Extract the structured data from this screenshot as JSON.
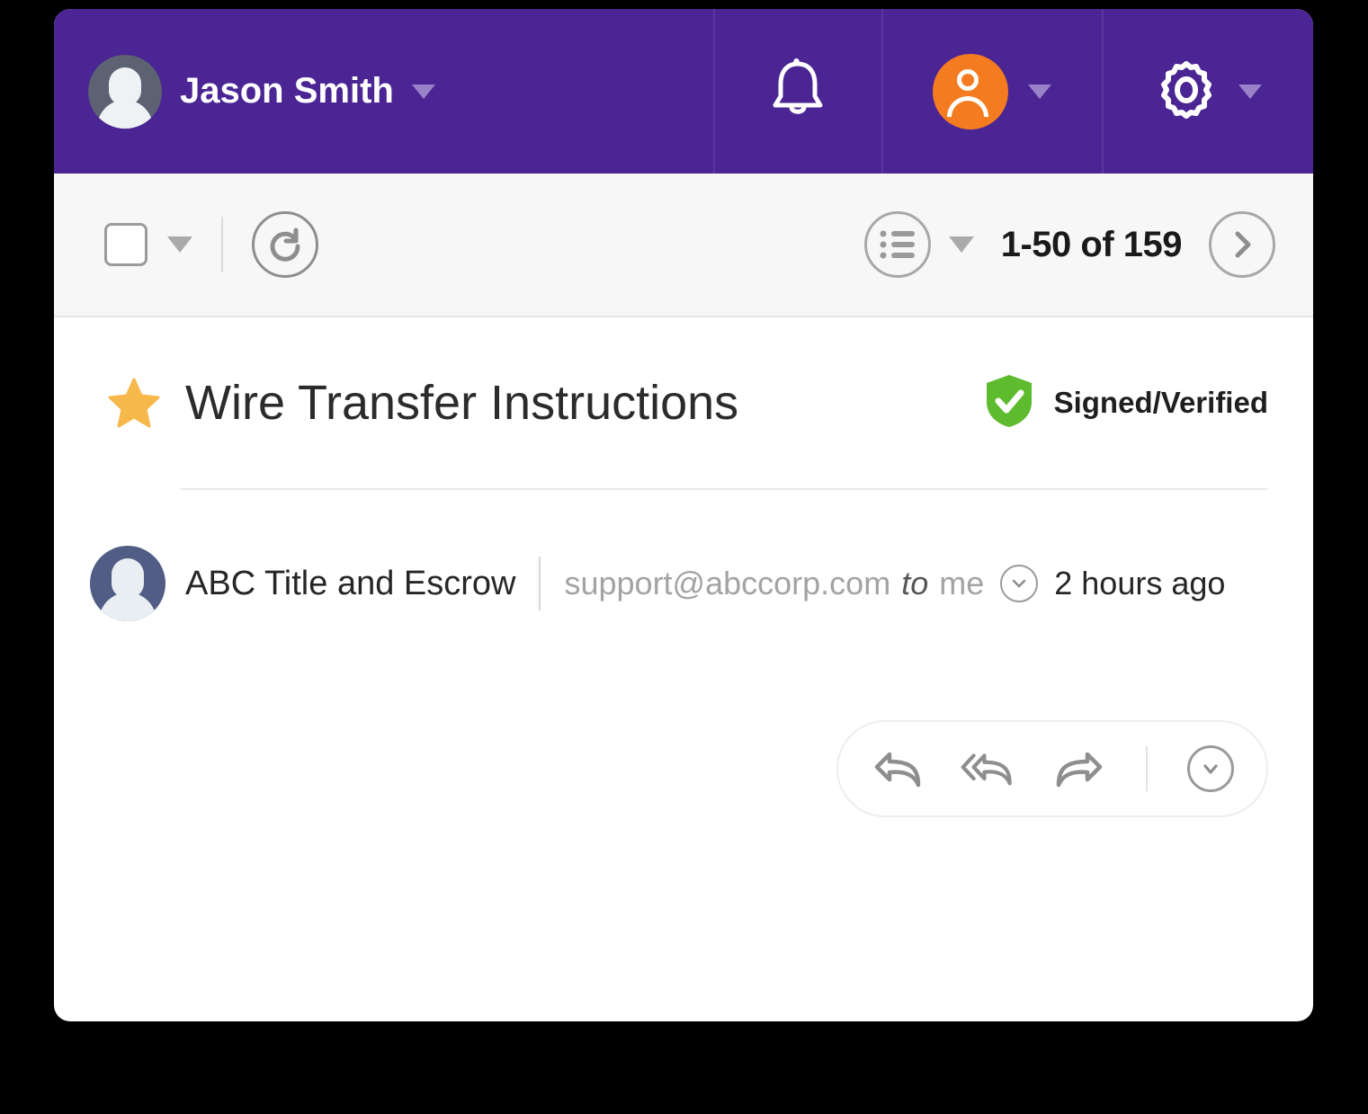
{
  "header": {
    "user_name": "Jason Smith",
    "user_avatar_icon": "person-avatar-icon",
    "user_caret_icon": "chevron-down-icon",
    "bell_icon": "bell-notification-icon",
    "account_avatar_icon": "account-person-icon",
    "account_caret_icon": "chevron-down-icon",
    "gear_icon": "gear-settings-icon",
    "gear_caret_icon": "chevron-down-icon",
    "background_color": "#4A2593",
    "accent_orange": "#F47B20"
  },
  "toolbar": {
    "select_checkbox_icon": "empty-checkbox-icon",
    "select_caret_icon": "chevron-down-icon",
    "refresh_icon": "refresh-circle-icon",
    "list_view_icon": "list-lines-circle-icon",
    "list_caret_icon": "chevron-down-icon",
    "pagination_label": "1-50 of 159",
    "next_page_icon": "chevron-right-circle-icon"
  },
  "email": {
    "star_icon": "star-filled-icon",
    "star_color": "#F7B84B",
    "subject": "Wire Transfer Instructions",
    "verified_icon": "shield-check-icon",
    "verified_color": "#5FBB2E",
    "verified_label": "Signed/Verified",
    "sender": {
      "avatar_icon": "person-avatar-icon",
      "name": "ABC Title and Escrow",
      "email": "support@abccorp.com",
      "to_word": "to",
      "recipient": "me",
      "details_caret_icon": "chevron-down-circle-icon",
      "timestamp": "2 hours ago"
    },
    "actions": {
      "reply_icon": "reply-arrow-icon",
      "reply_all_icon": "reply-all-arrow-icon",
      "forward_icon": "forward-arrow-icon",
      "more_icon": "chevron-down-circle-icon"
    }
  }
}
